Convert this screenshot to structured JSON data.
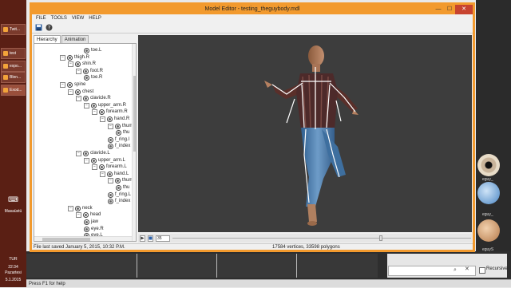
{
  "window": {
    "title": "Model Editor - testing_theguybody.mdl"
  },
  "menu": [
    "FILE",
    "TOOLS",
    "VIEW",
    "HELP"
  ],
  "tabs": [
    "Hierarchy",
    "Animation"
  ],
  "tree": [
    {
      "label": "toe.L",
      "expander": ""
    },
    {
      "label": "thigh.R",
      "expander": "−"
    },
    {
      "label": "shin.R",
      "expander": "−"
    },
    {
      "label": "foot.R",
      "expander": "−"
    },
    {
      "label": "toe.R",
      "expander": ""
    },
    {
      "label": "spine",
      "expander": "−"
    },
    {
      "label": "chest",
      "expander": "−"
    },
    {
      "label": "clavicle.R",
      "expander": "−"
    },
    {
      "label": "upper_arm.R",
      "expander": "−"
    },
    {
      "label": "forearm.R",
      "expander": "−"
    },
    {
      "label": "hand.R",
      "expander": "−"
    },
    {
      "label": "thumb",
      "expander": "−"
    },
    {
      "label": "thu",
      "expander": ""
    },
    {
      "label": "f_ring.l",
      "expander": ""
    },
    {
      "label": "f_index",
      "expander": ""
    },
    {
      "label": "clavicle.L",
      "expander": "−"
    },
    {
      "label": "upper_arm.L",
      "expander": "−"
    },
    {
      "label": "forearm.L",
      "expander": "−"
    },
    {
      "label": "hand.L",
      "expander": "−"
    },
    {
      "label": "thumb",
      "expander": "−"
    },
    {
      "label": "thu",
      "expander": ""
    },
    {
      "label": "f_ring.L",
      "expander": ""
    },
    {
      "label": "f_index",
      "expander": ""
    },
    {
      "label": "neck",
      "expander": "−"
    },
    {
      "label": "head",
      "expander": "−"
    },
    {
      "label": "jaw",
      "expander": ""
    },
    {
      "label": "eye.R",
      "expander": ""
    },
    {
      "label": "eye.L",
      "expander": ""
    }
  ],
  "timeline": {
    "frame": "35",
    "position": 0.7
  },
  "status": {
    "saved": "File last saved January 5, 2015, 10:32 P.M.",
    "stats": "17584 vertices, 33598 polygons"
  },
  "statusbar_help": "Press F1 for help",
  "taskbar": {
    "apps": [
      "Twit...",
      "test",
      "expo...",
      "Blen...",
      "Exod..."
    ],
    "lang_label": "Masaüstü",
    "lang": "TUR",
    "time": "22:34",
    "day": "Pazartesi",
    "date": "5.1.2015"
  },
  "bg_app": {
    "recursive_label": "Recursive",
    "thumb_labels": [
      "eguy_",
      "eguy_",
      "eguyS"
    ]
  },
  "colors": {
    "title_accent": "#f29a2e",
    "viewport_bg": "#3d3d3d"
  }
}
